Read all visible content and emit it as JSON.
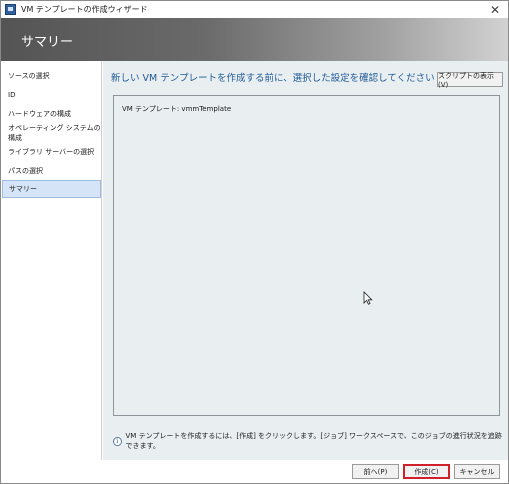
{
  "window": {
    "title": "VM テンプレートの作成ウィザード",
    "close_glyph": "✕"
  },
  "banner": {
    "title": "サマリー"
  },
  "sidebar": {
    "items": [
      {
        "label": "ソースの選択"
      },
      {
        "label": "ID"
      },
      {
        "label": "ハードウェアの構成"
      },
      {
        "label": "オペレーティング システムの構成"
      },
      {
        "label": "ライブラリ サーバーの選択"
      },
      {
        "label": "パスの選択"
      },
      {
        "label": "サマリー"
      }
    ],
    "selected_index": 6
  },
  "main": {
    "heading": "新しい VM テンプレートを作成する前に、選択した設定を確認してください",
    "script_button_label": "スクリプトの表示(V)",
    "summary_line": "VM テンプレート: vmmTemplate",
    "info_text": "VM テンプレートを作成するには、[作成] をクリックします。[ジョブ] ワークスペースで、このジョブの進行状況を追跡できます。"
  },
  "footer": {
    "back_label": "前へ(P)",
    "create_label": "作成(C)",
    "cancel_label": "キャンセル"
  },
  "colors": {
    "accent": "#1e5a96",
    "highlight": "#d0202a",
    "selection": "#d5e4f6"
  }
}
